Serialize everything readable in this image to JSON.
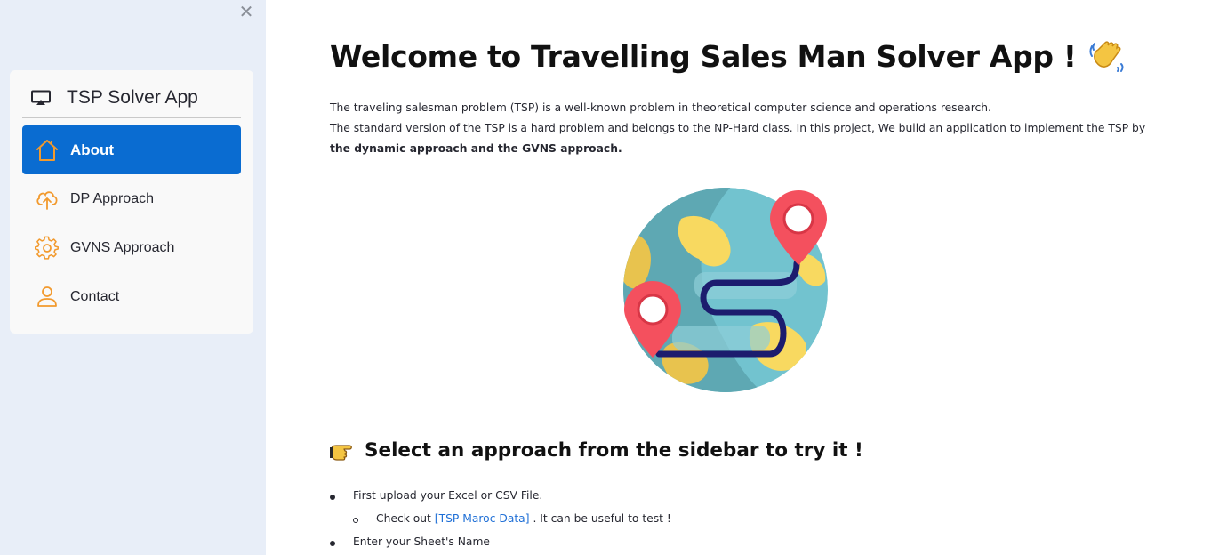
{
  "sidebar": {
    "close_glyph": "✕",
    "menu_title": "TSP Solver App",
    "menu_title_icon": "cast-icon",
    "items": [
      {
        "label": "About",
        "icon": "house-icon",
        "active": true
      },
      {
        "label": "DP Approach",
        "icon": "cloud-upload-icon",
        "active": false
      },
      {
        "label": "GVNS Approach",
        "icon": "gear-icon",
        "active": false
      },
      {
        "label": "Contact",
        "icon": "person-icon",
        "active": false
      }
    ],
    "active_color": "#0a6cd1",
    "icon_color": "#f29a2e"
  },
  "main": {
    "title": "Welcome to Travelling Sales Man Solver App !",
    "intro_line1": "The traveling salesman problem (TSP) is a well-known problem in theoretical computer science and operations research.",
    "intro_line2_plain": "The standard version of the TSP is a hard problem and belongs to the NP-Hard class. In this project, We build an application to implement the TSP by ",
    "intro_line2_bold": "the dynamic approach and the GVNS approach.",
    "section_title": "Select an approach from the sidebar to try it !",
    "bullets": {
      "upload": "First upload your Excel or CSV File.",
      "checkout_prefix": "Check out ",
      "checkout_link": "[TSP Maroc Data]",
      "checkout_suffix": " . It can be useful to test !",
      "sheet_name": "Enter your Sheet's Name"
    }
  }
}
